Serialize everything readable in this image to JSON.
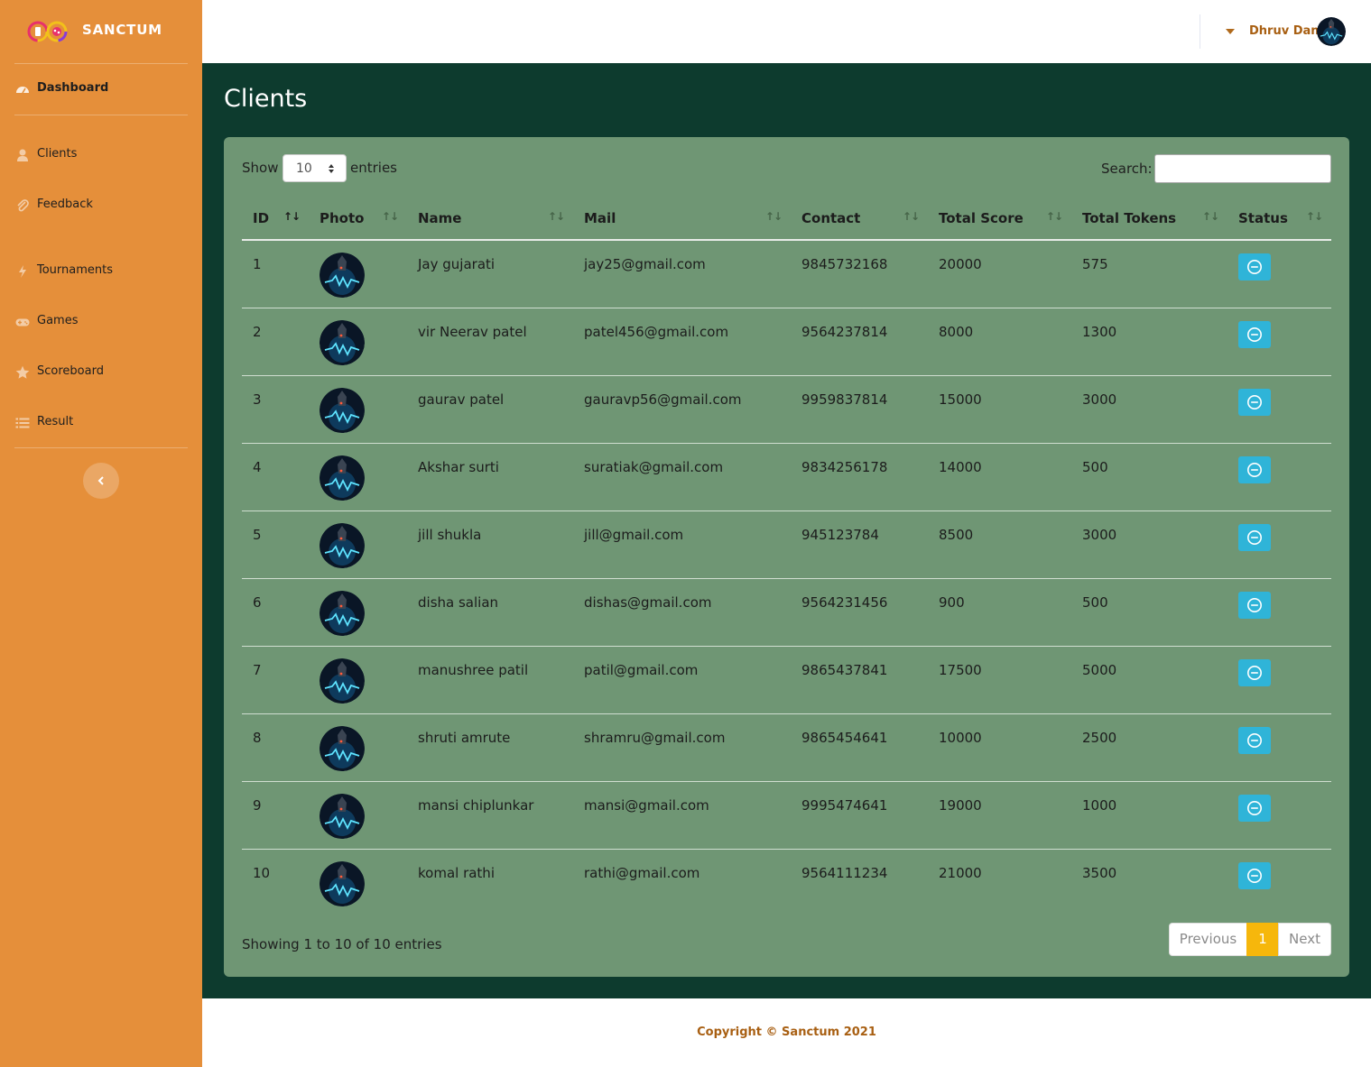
{
  "app": {
    "name": "SANCTUM"
  },
  "sidebar": {
    "items": [
      {
        "label": "Dashboard",
        "icon": "tachometer-icon"
      },
      {
        "label": "Clients",
        "icon": "user-icon"
      },
      {
        "label": "Feedback",
        "icon": "paperclip-icon"
      },
      {
        "label": "Tournaments",
        "icon": "bolt-icon"
      },
      {
        "label": "Games",
        "icon": "gamepad-icon"
      },
      {
        "label": "Scoreboard",
        "icon": "star-icon"
      },
      {
        "label": "Result",
        "icon": "list-icon"
      }
    ],
    "collapse_icon": "chevron-left-icon"
  },
  "topbar": {
    "user_name": "Dhruv Dani"
  },
  "page": {
    "title": "Clients"
  },
  "table_controls": {
    "show_label": "Show",
    "entries_label": "entries",
    "page_length": "10",
    "search_label": "Search:",
    "search_value": ""
  },
  "table": {
    "columns": [
      "ID",
      "Photo",
      "Name",
      "Mail",
      "Contact",
      "Total Score",
      "Total Tokens",
      "Status"
    ],
    "rows": [
      {
        "id": "1",
        "name": "Jay gujarati",
        "mail": "jay25@gmail.com",
        "contact": "9845732168",
        "score": "20000",
        "tokens": "575"
      },
      {
        "id": "2",
        "name": "vir Neerav patel",
        "mail": "patel456@gmail.com",
        "contact": "9564237814",
        "score": "8000",
        "tokens": "1300"
      },
      {
        "id": "3",
        "name": "gaurav patel",
        "mail": "gauravp56@gmail.com",
        "contact": "9959837814",
        "score": "15000",
        "tokens": "3000"
      },
      {
        "id": "4",
        "name": "Akshar surti",
        "mail": "suratiak@gmail.com",
        "contact": "9834256178",
        "score": "14000",
        "tokens": "500"
      },
      {
        "id": "5",
        "name": "jill shukla",
        "mail": "jill@gmail.com",
        "contact": "945123784",
        "score": "8500",
        "tokens": "3000"
      },
      {
        "id": "6",
        "name": "disha salian",
        "mail": "dishas@gmail.com",
        "contact": "9564231456",
        "score": "900",
        "tokens": "500"
      },
      {
        "id": "7",
        "name": "manushree patil",
        "mail": "patil@gmail.com",
        "contact": "9865437841",
        "score": "17500",
        "tokens": "5000"
      },
      {
        "id": "8",
        "name": "shruti amrute",
        "mail": "shramru@gmail.com",
        "contact": "9865454641",
        "score": "10000",
        "tokens": "2500"
      },
      {
        "id": "9",
        "name": "mansi chiplunkar",
        "mail": "mansi@gmail.com",
        "contact": "9995474641",
        "score": "19000",
        "tokens": "1000"
      },
      {
        "id": "10",
        "name": "komal rathi",
        "mail": "rathi@gmail.com",
        "contact": "9564111234",
        "score": "21000",
        "tokens": "3500"
      }
    ]
  },
  "table_info": "Showing 1 to 10 of 10 entries",
  "pagination": {
    "previous": "Previous",
    "current": "1",
    "next": "Next"
  },
  "footer": {
    "copyright": "Copyright © Sanctum 2021"
  },
  "colors": {
    "sidebar": "#e58f3a",
    "main_bg": "#0d3b2e",
    "card_bg": "#6f9674",
    "status_button": "#2fb4d8",
    "active_page": "#f6b70c",
    "user_name": "#a85f12"
  }
}
